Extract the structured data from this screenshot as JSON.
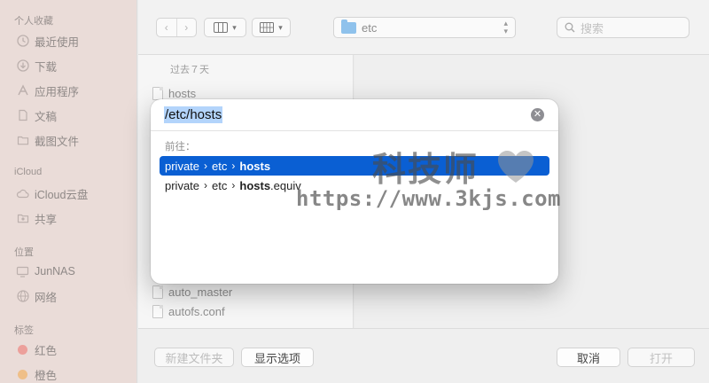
{
  "sidebar": {
    "sections": [
      {
        "title": "个人收藏"
      },
      {
        "title": "iCloud"
      },
      {
        "title": "位置"
      },
      {
        "title": "标签"
      }
    ],
    "favorites": [
      {
        "label": "最近使用",
        "icon": "clock-icon"
      },
      {
        "label": "下载",
        "icon": "download-icon"
      },
      {
        "label": "应用程序",
        "icon": "apps-icon"
      },
      {
        "label": "文稿",
        "icon": "document-icon"
      },
      {
        "label": "截图文件",
        "icon": "folder-icon"
      }
    ],
    "icloud": [
      {
        "label": "iCloud云盘",
        "icon": "cloud-icon"
      },
      {
        "label": "共享",
        "icon": "shared-folder-icon"
      }
    ],
    "locations": [
      {
        "label": "JunNAS",
        "icon": "server-icon"
      },
      {
        "label": "网络",
        "icon": "network-icon"
      }
    ],
    "tags": [
      {
        "label": "红色",
        "color": "#e7675f"
      },
      {
        "label": "橙色",
        "color": "#eea04a"
      }
    ]
  },
  "toolbar": {
    "path_value": "etc",
    "search_placeholder": "搜索"
  },
  "filelist": {
    "header": "过去７天",
    "items": [
      {
        "name": "hosts"
      },
      {
        "name": "auto_master"
      },
      {
        "name": "autofs.conf"
      }
    ]
  },
  "footer": {
    "new_folder": "新建文件夹",
    "show_options": "显示选项",
    "cancel": "取消",
    "open": "打开"
  },
  "goto_sheet": {
    "path_input": "/etc/hosts",
    "go_label": "前往：",
    "suggestions": [
      {
        "parts": [
          "private",
          "etc"
        ],
        "match": "hosts",
        "rest": "",
        "selected": true
      },
      {
        "parts": [
          "private",
          "etc"
        ],
        "match": "hosts",
        "rest": ".equiv",
        "selected": false
      }
    ]
  },
  "watermark": {
    "title": "科技师",
    "url": "https://www.3kjs.com"
  },
  "colors": {
    "selection": "#0a5fd3",
    "text_highlight": "#b3d4fb",
    "sidebar_bg": "#eadcd8"
  }
}
